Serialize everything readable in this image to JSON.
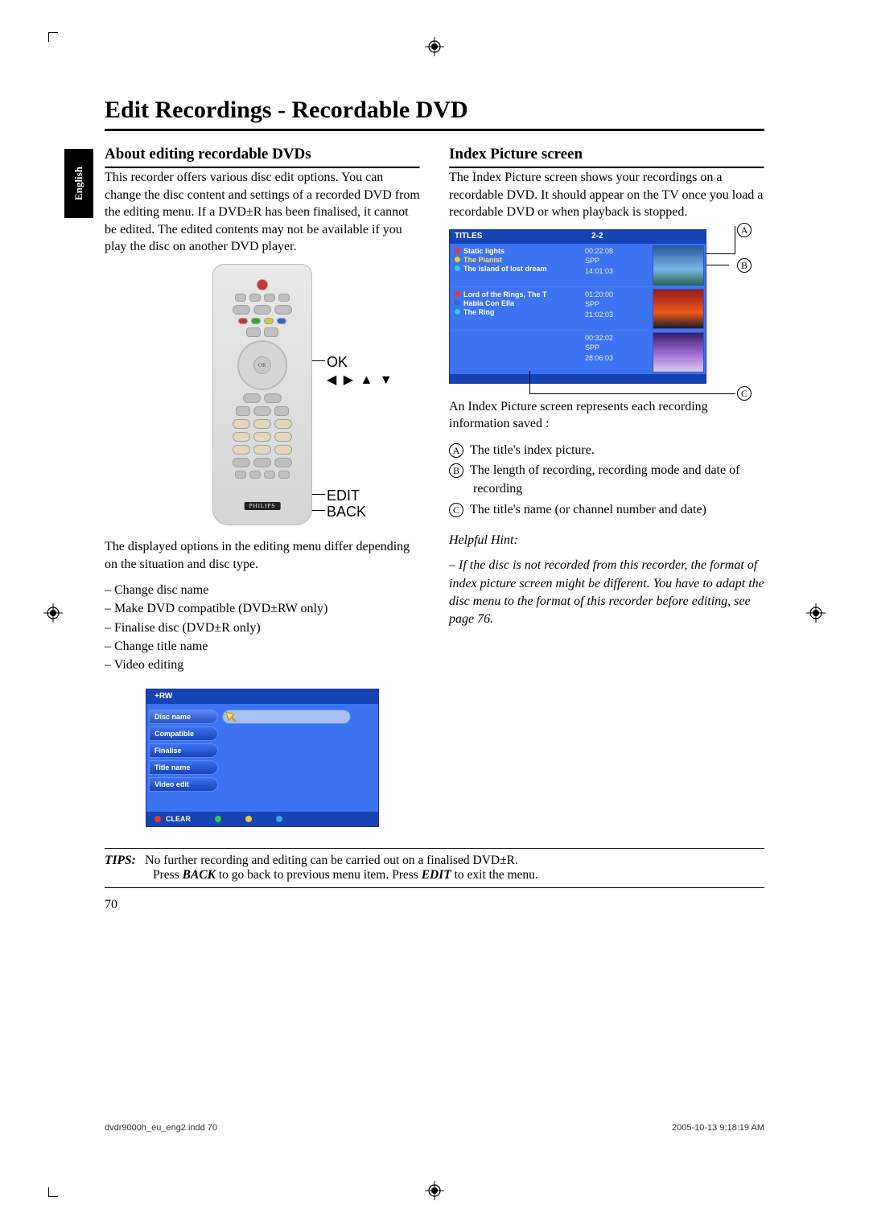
{
  "crop_marks": true,
  "side_tab": "English",
  "main_title": "Edit Recordings - Recordable DVD",
  "left": {
    "heading": "About editing recordable DVDs",
    "paragraph1": "This recorder offers various disc edit options. You can change the disc content and settings of a recorded DVD from the editing menu. If a DVD±R has been finalised, it cannot be edited. The edited contents may not be available if you play the disc on another DVD player.",
    "remote_labels": {
      "ok": "OK",
      "arrows": "◀ ▶ ▲ ▼",
      "edit": "EDIT",
      "back": "BACK"
    },
    "remote_brand": "PHILIPS",
    "paragraph2": "The displayed options in the editing menu differ depending on the situation and disc type.",
    "dash_items": [
      "Change disc name",
      "Make DVD compatible (DVD±RW only)",
      "Finalise disc (DVD±R only)",
      "Change title name",
      "Video editing"
    ],
    "edit_menu": {
      "top": "+RW",
      "items": [
        "Disc name",
        "Compatible",
        "Finalise",
        "Title name",
        "Video edit"
      ],
      "clear": "CLEAR"
    }
  },
  "right": {
    "heading": "Index Picture screen",
    "paragraph1": "The Index Picture screen shows your recordings on a recordable DVD.  It should appear on the TV once you load a recordable DVD or when playback is stopped.",
    "ips": {
      "head": {
        "titles": "TITLES",
        "count": "2-2"
      },
      "rows": [
        {
          "titles": [
            "Static lights",
            "The Pianist",
            "The island of lost dream"
          ],
          "hl": 1,
          "time": "00:22:08",
          "mode": "SPP",
          "date": "14:01:03"
        },
        {
          "titles": [
            "Lord of the Rings, The T",
            "Habla Con Ella",
            "The Ring"
          ],
          "time_top": "01:20:00",
          "mode_top": "SPP",
          "date_top": "21:02:03",
          "time": "00:32:02",
          "mode": "SPP",
          "date": "28:06:03"
        }
      ]
    },
    "paragraph2": "An Index Picture screen represents each recording information saved :",
    "abc_items": [
      "The title's index picture.",
      "The length of recording, recording mode and date of recording",
      "The title's name (or channel number and date)"
    ],
    "hint_label": "Helpful Hint:",
    "hint_body": "– If the disc is not recorded from this recorder, the format of index picture screen might be different. You have to adapt the disc menu to the format of this recorder before editing, see page 76."
  },
  "tips": {
    "label": "TIPS:",
    "line1": "No further recording and editing can be carried out on a finalised DVD±R.",
    "line2_a": "Press ",
    "line2_b": "BACK",
    "line2_c": " to go back to previous menu item. Press ",
    "line2_d": "EDIT",
    "line2_e": " to exit the menu."
  },
  "page_number": "70",
  "footer": {
    "left": "dvdr9000h_eu_eng2.indd   70",
    "right": "2005-10-13   9:18:19 AM"
  }
}
